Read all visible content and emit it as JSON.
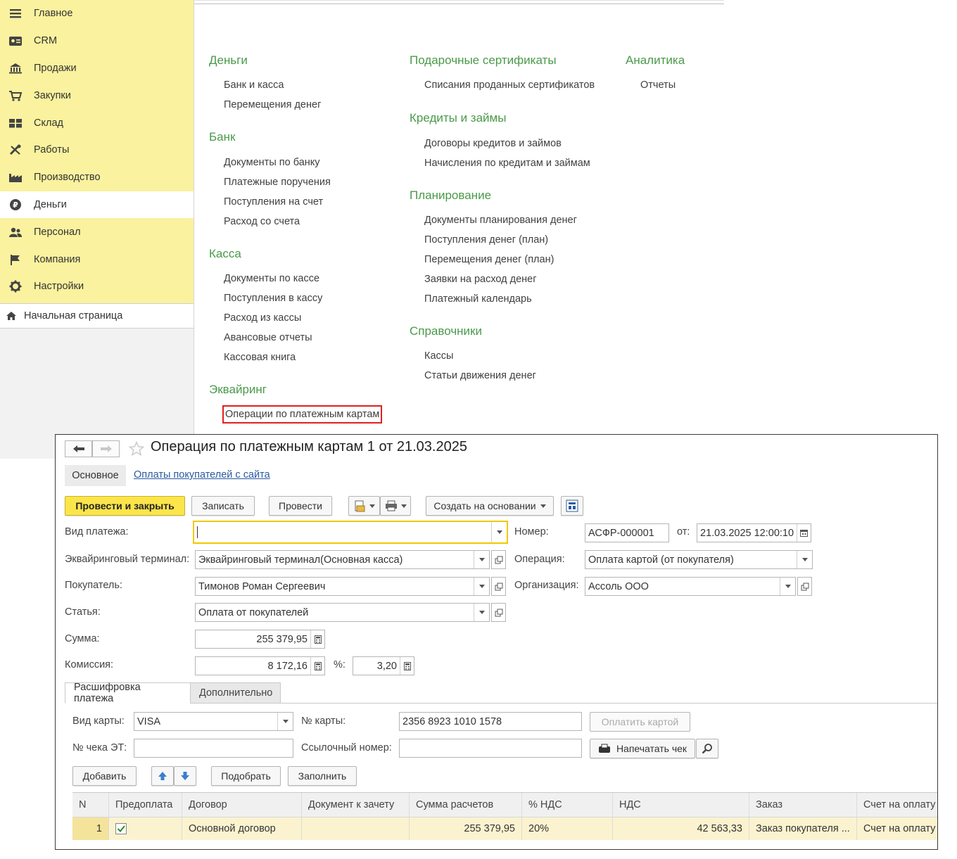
{
  "sidebar": {
    "items": [
      {
        "label": "Главное",
        "icon": "menu-lines-icon"
      },
      {
        "label": "CRM",
        "icon": "contact-card-icon"
      },
      {
        "label": "Продажи",
        "icon": "shop-icon"
      },
      {
        "label": "Закупки",
        "icon": "cart-icon"
      },
      {
        "label": "Склад",
        "icon": "warehouse-icon"
      },
      {
        "label": "Работы",
        "icon": "tools-icon"
      },
      {
        "label": "Производство",
        "icon": "factory-icon"
      },
      {
        "label": "Деньги",
        "icon": "ruble-icon"
      },
      {
        "label": "Персонал",
        "icon": "people-icon"
      },
      {
        "label": "Компания",
        "icon": "flag-icon"
      },
      {
        "label": "Настройки",
        "icon": "gear-icon"
      }
    ],
    "active": "Деньги",
    "home": "Начальная страница"
  },
  "menu": {
    "money": {
      "title": "Деньги",
      "links": [
        "Банк и касса",
        "Перемещения денег"
      ]
    },
    "bank": {
      "title": "Банк",
      "links": [
        "Документы по банку",
        "Платежные поручения",
        "Поступления на счет",
        "Расход со счета"
      ]
    },
    "cash": {
      "title": "Касса",
      "links": [
        "Документы по кассе",
        "Поступления в кассу",
        "Расход из кассы",
        "Авансовые отчеты",
        "Кассовая книга"
      ]
    },
    "acquiring": {
      "title": "Эквайринг",
      "links": [
        "Операции по платежным картам"
      ]
    },
    "gift": {
      "title": "Подарочные сертификаты",
      "links": [
        "Списания проданных сертификатов"
      ]
    },
    "credits": {
      "title": "Кредиты и займы",
      "links": [
        "Договоры кредитов и займов",
        "Начисления по кредитам и займам"
      ]
    },
    "planning": {
      "title": "Планирование",
      "links": [
        "Документы планирования денег",
        "Поступления денег (план)",
        "Перемещения денег (план)",
        "Заявки на расход денег",
        "Платежный календарь"
      ]
    },
    "refs": {
      "title": "Справочники",
      "links": [
        "Кассы",
        "Статьи движения денег"
      ]
    },
    "analytics": {
      "title": "Аналитика",
      "links": [
        "Отчеты"
      ]
    }
  },
  "doc": {
    "title": "Операция по платежным картам 1 от 21.03.2025",
    "tabs_top": {
      "main": "Основное",
      "link": "Оплаты покупателей с сайта"
    },
    "toolbar": {
      "post_close": "Провести и закрыть",
      "save": "Записать",
      "post": "Провести",
      "create_based": "Создать на основании"
    },
    "labels": {
      "payment_type": "Вид платежа:",
      "terminal": "Эквайринговый терминал:",
      "buyer": "Покупатель:",
      "article": "Статья:",
      "sum": "Сумма:",
      "commission": "Комиссия:",
      "percent": "%:",
      "number": "Номер:",
      "from": "от:",
      "operation": "Операция:",
      "org": "Организация:"
    },
    "values": {
      "payment_type": "",
      "terminal": "Эквайринговый терминал(Основная касса)",
      "buyer": "Тимонов Роман Сергеевич",
      "article": "Оплата от покупателей",
      "sum": "255 379,95",
      "commission": "8 172,16",
      "percent": "3,20",
      "number": "АСФР-000001",
      "date": "21.03.2025 12:00:10",
      "operation": "Оплата картой (от покупателя)",
      "org": "Ассоль ООО"
    },
    "inner_tabs": [
      "Расшифровка платежа",
      "Дополнительно"
    ],
    "card": {
      "card_type_label": "Вид карты:",
      "card_type": "VISA",
      "card_no_label": "№ карты:",
      "card_no": "2356 8923 1010 1578",
      "pay_card_btn": "Оплатить картой",
      "check_label": "№ чека ЭТ:",
      "check_value": "",
      "ref_label": "Ссылочный номер:",
      "ref_value": "",
      "print_btn": "Напечатать чек"
    },
    "table_toolbar": {
      "add": "Добавить",
      "pick": "Подобрать",
      "fill": "Заполнить"
    },
    "columns": [
      "N",
      "Предоплата",
      "Договор",
      "Документ к зачету",
      "Сумма расчетов",
      "% НДС",
      "НДС",
      "Заказ",
      "Счет на оплату"
    ],
    "rows": [
      {
        "n": "1",
        "prepaid": true,
        "contract": "Основной договор",
        "offset_doc": "",
        "amount": "255 379,95",
        "vat_rate": "20%",
        "vat": "42 563,33",
        "order": "Заказ покупателя ...",
        "invoice": "Счет на оплату"
      }
    ]
  }
}
